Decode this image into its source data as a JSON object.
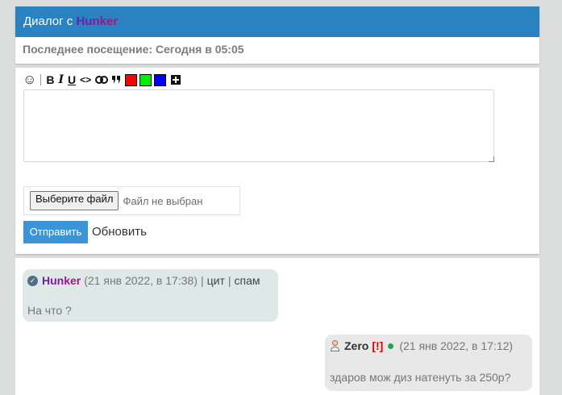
{
  "dialog": {
    "title_prefix": "Диалог с",
    "username": "Hunker",
    "last_seen": "Последнее посещение: Сегодня в 05:05"
  },
  "toolbar": {
    "bold": "B",
    "italic": "I",
    "underline": "U",
    "code": "<>",
    "link": "🔗",
    "quote": "❞",
    "colors": [
      "#ff0000",
      "#00ee00",
      "#0000ff"
    ],
    "more": "+",
    "emoji": "☺"
  },
  "editor": {
    "text": "",
    "file_button": "Выберите файл",
    "file_status": "Файл не выбран",
    "send_button": "Отправить",
    "refresh_link": "Обновить"
  },
  "messages": [
    {
      "author": "Hunker",
      "verified": true,
      "timestamp": "(21 янв 2022, в 17:38)",
      "actions": [
        "цит",
        "спам"
      ],
      "text": "На что ?"
    },
    {
      "author": "Zero",
      "flag": "[!]",
      "online": true,
      "timestamp": "(21 янв 2022, в 17:12)",
      "text": "здаров мож диз натенуть за 250р?"
    }
  ]
}
